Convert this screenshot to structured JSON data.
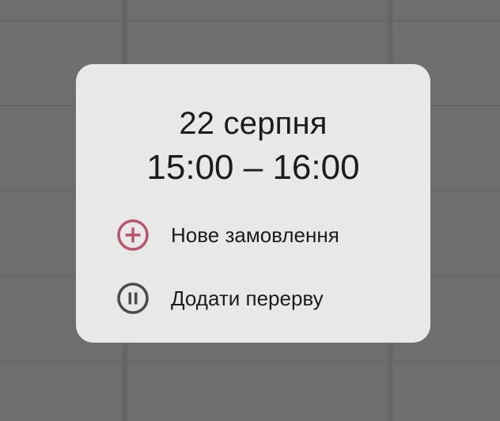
{
  "dialog": {
    "date": "22 серпня",
    "time_range": "15:00 – 16:00",
    "actions": [
      {
        "label": "Нове замовлення",
        "icon": "plus-circle-icon",
        "color": "#b8566e"
      },
      {
        "label": "Додати перерву",
        "icon": "pause-circle-icon",
        "color": "#4a4a4a"
      }
    ]
  },
  "colors": {
    "scrim": "#6e6e6e",
    "dialog_background": "#e8e8e8",
    "accent": "#b8566e",
    "text": "#1c1c1c"
  }
}
